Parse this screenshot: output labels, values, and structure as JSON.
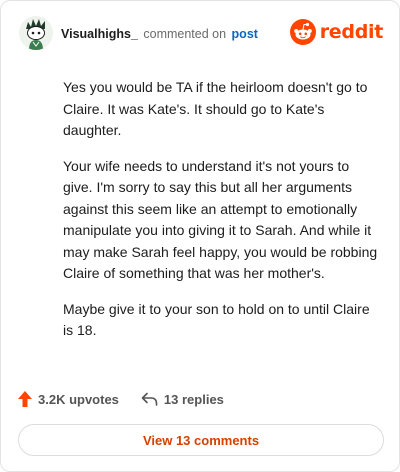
{
  "header": {
    "username": "Visualhighs_",
    "action_text": "commented on",
    "link_text": "post",
    "brand": "reddit",
    "accent_color": "#ff4500",
    "avatar_icon": "snoo-avatar-icon",
    "brand_icon": "reddit-snoo-icon"
  },
  "comment": {
    "paragraphs": [
      "Yes you would be TA if the heirloom doesn't go to Claire. It was Kate's. It should go to Kate's daughter.",
      "Your wife needs to understand it's not yours to give. I'm sorry to say this but all her arguments against this seem like an attempt to emotionally manipulate you into giving it to Sarah. And while it may make Sarah feel happy, you would be robbing Claire of something that was her mother's.",
      "Maybe give it to your son to hold on to until Claire is 18."
    ]
  },
  "footer": {
    "upvotes": "3.2K upvotes",
    "replies": "13 replies",
    "view_comments": "View 13 comments",
    "upvote_icon": "upvote-arrow-icon",
    "reply_icon": "reply-arrow-icon"
  }
}
